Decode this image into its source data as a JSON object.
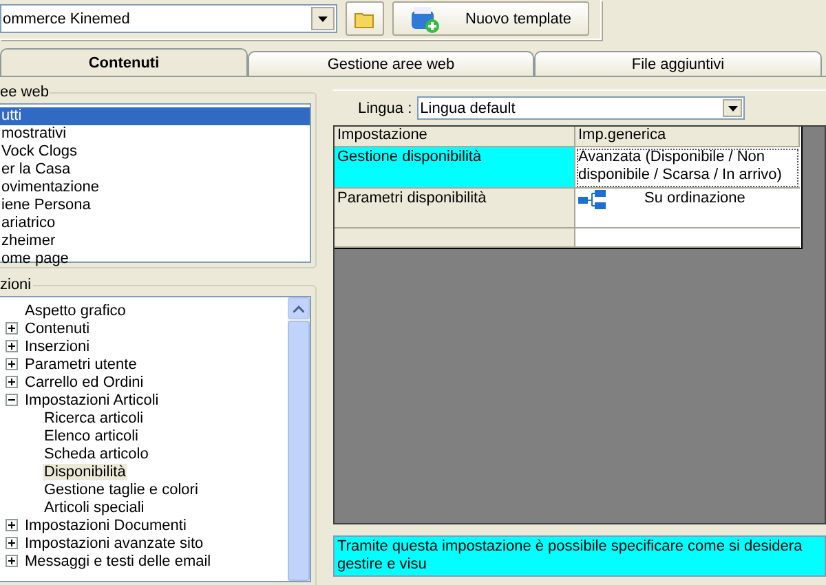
{
  "toolbar": {
    "template_combo": "ommerce Kinemed",
    "new_template_button": "Nuovo template"
  },
  "tabs": [
    {
      "label": "Contenuti",
      "selected": true
    },
    {
      "label": "Gestione aree web",
      "selected": false
    },
    {
      "label": "File aggiuntivi",
      "selected": false
    }
  ],
  "areas_group": {
    "title": "ee web",
    "items": [
      {
        "label": "utti",
        "selected": true
      },
      {
        "label": "mostrativi",
        "selected": false
      },
      {
        "label": "Vock Clogs",
        "selected": false
      },
      {
        "label": "er la Casa",
        "selected": false
      },
      {
        "label": "ovimentazione",
        "selected": false
      },
      {
        "label": "iene Persona",
        "selected": false
      },
      {
        "label": "ariatrico",
        "selected": false
      },
      {
        "label": "zheimer",
        "selected": false
      },
      {
        "label": "ome page",
        "selected": false
      }
    ]
  },
  "sections_group": {
    "title": "zioni",
    "tree": [
      {
        "label": "Aspetto grafico",
        "selected": false
      },
      {
        "label": "Contenuti",
        "selected": false,
        "expanded": false
      },
      {
        "label": "Inserzioni",
        "selected": false,
        "expanded": false
      },
      {
        "label": "Parametri utente",
        "selected": false,
        "expanded": false
      },
      {
        "label": "Carrello ed Ordini",
        "selected": false,
        "expanded": false
      },
      {
        "label": "Impostazioni Articoli",
        "selected": false,
        "expanded": true,
        "children": [
          {
            "label": "Ricerca articoli",
            "selected": false
          },
          {
            "label": "Elenco articoli",
            "selected": false
          },
          {
            "label": "Scheda articolo",
            "selected": false
          },
          {
            "label": "Disponibilità",
            "selected": true
          },
          {
            "label": "Gestione taglie e colori",
            "selected": false
          },
          {
            "label": "Articoli speciali",
            "selected": false
          }
        ]
      },
      {
        "label": "Impostazioni Documenti",
        "selected": false,
        "expanded": false
      },
      {
        "label": "Impostazioni avanzate sito",
        "selected": false,
        "expanded": false
      },
      {
        "label": "Messaggi e testi delle email",
        "selected": false,
        "expanded": false
      }
    ]
  },
  "language": {
    "label": "Lingua :",
    "value": "Lingua default"
  },
  "grid": {
    "columns": [
      "Impostazione",
      "Imp.generica"
    ],
    "rows": [
      {
        "kind": "text",
        "selected": true,
        "setting": "Gestione disponibilità",
        "value": "Avanzata (Disponibile / Non disponibile / Scarsa / In arrivo)"
      },
      {
        "kind": "linked",
        "selected": false,
        "setting": "Parametri disponibilità",
        "value": "Su ordinazione"
      },
      {
        "kind": "empty",
        "selected": false
      }
    ]
  },
  "description": "Tramite questa impostazione è possibile specificare come si desidera gestire e visu"
}
